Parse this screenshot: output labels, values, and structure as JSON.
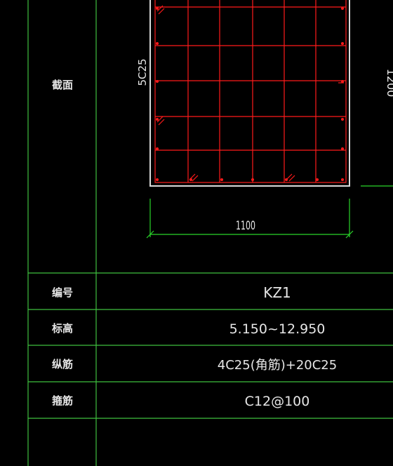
{
  "drawing": {
    "section_label": "截面",
    "side_rebar_label": "5C25",
    "height_dim": "1200",
    "width_dim": "1100"
  },
  "table": {
    "rows": [
      {
        "label": "编号",
        "value": "KZ1"
      },
      {
        "label": "标高",
        "value": "5.150~12.950"
      },
      {
        "label": "纵筋",
        "value": "4C25(角筋)+20C25"
      },
      {
        "label": "箍筋",
        "value": "C12@100"
      }
    ]
  },
  "colors": {
    "table_lines": "#3fbf3f",
    "rebar": "#ff1a1a",
    "concrete_outline": "#dcdcdc",
    "dimension": "#2ad62a",
    "text": "#e6e6e6",
    "background": "#000000"
  }
}
